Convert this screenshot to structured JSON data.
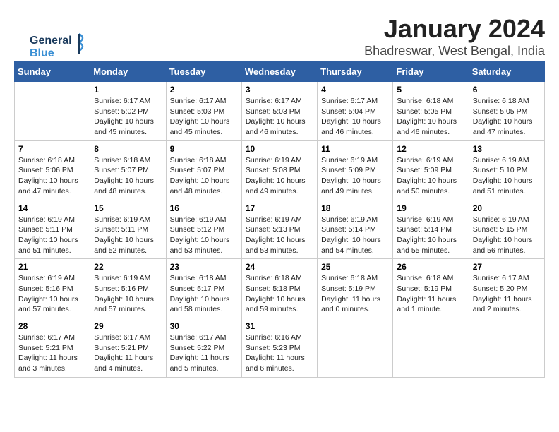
{
  "logo": {
    "line1": "General",
    "line2": "Blue"
  },
  "header": {
    "month_year": "January 2024",
    "location": "Bhadreswar, West Bengal, India"
  },
  "days_of_week": [
    "Sunday",
    "Monday",
    "Tuesday",
    "Wednesday",
    "Thursday",
    "Friday",
    "Saturday"
  ],
  "weeks": [
    [
      {
        "day": "",
        "sunrise": "",
        "sunset": "",
        "daylight": ""
      },
      {
        "day": "1",
        "sunrise": "Sunrise: 6:17 AM",
        "sunset": "Sunset: 5:02 PM",
        "daylight": "Daylight: 10 hours and 45 minutes."
      },
      {
        "day": "2",
        "sunrise": "Sunrise: 6:17 AM",
        "sunset": "Sunset: 5:03 PM",
        "daylight": "Daylight: 10 hours and 45 minutes."
      },
      {
        "day": "3",
        "sunrise": "Sunrise: 6:17 AM",
        "sunset": "Sunset: 5:03 PM",
        "daylight": "Daylight: 10 hours and 46 minutes."
      },
      {
        "day": "4",
        "sunrise": "Sunrise: 6:17 AM",
        "sunset": "Sunset: 5:04 PM",
        "daylight": "Daylight: 10 hours and 46 minutes."
      },
      {
        "day": "5",
        "sunrise": "Sunrise: 6:18 AM",
        "sunset": "Sunset: 5:05 PM",
        "daylight": "Daylight: 10 hours and 46 minutes."
      },
      {
        "day": "6",
        "sunrise": "Sunrise: 6:18 AM",
        "sunset": "Sunset: 5:05 PM",
        "daylight": "Daylight: 10 hours and 47 minutes."
      }
    ],
    [
      {
        "day": "7",
        "sunrise": "Sunrise: 6:18 AM",
        "sunset": "Sunset: 5:06 PM",
        "daylight": "Daylight: 10 hours and 47 minutes."
      },
      {
        "day": "8",
        "sunrise": "Sunrise: 6:18 AM",
        "sunset": "Sunset: 5:07 PM",
        "daylight": "Daylight: 10 hours and 48 minutes."
      },
      {
        "day": "9",
        "sunrise": "Sunrise: 6:18 AM",
        "sunset": "Sunset: 5:07 PM",
        "daylight": "Daylight: 10 hours and 48 minutes."
      },
      {
        "day": "10",
        "sunrise": "Sunrise: 6:19 AM",
        "sunset": "Sunset: 5:08 PM",
        "daylight": "Daylight: 10 hours and 49 minutes."
      },
      {
        "day": "11",
        "sunrise": "Sunrise: 6:19 AM",
        "sunset": "Sunset: 5:09 PM",
        "daylight": "Daylight: 10 hours and 49 minutes."
      },
      {
        "day": "12",
        "sunrise": "Sunrise: 6:19 AM",
        "sunset": "Sunset: 5:09 PM",
        "daylight": "Daylight: 10 hours and 50 minutes."
      },
      {
        "day": "13",
        "sunrise": "Sunrise: 6:19 AM",
        "sunset": "Sunset: 5:10 PM",
        "daylight": "Daylight: 10 hours and 51 minutes."
      }
    ],
    [
      {
        "day": "14",
        "sunrise": "Sunrise: 6:19 AM",
        "sunset": "Sunset: 5:11 PM",
        "daylight": "Daylight: 10 hours and 51 minutes."
      },
      {
        "day": "15",
        "sunrise": "Sunrise: 6:19 AM",
        "sunset": "Sunset: 5:11 PM",
        "daylight": "Daylight: 10 hours and 52 minutes."
      },
      {
        "day": "16",
        "sunrise": "Sunrise: 6:19 AM",
        "sunset": "Sunset: 5:12 PM",
        "daylight": "Daylight: 10 hours and 53 minutes."
      },
      {
        "day": "17",
        "sunrise": "Sunrise: 6:19 AM",
        "sunset": "Sunset: 5:13 PM",
        "daylight": "Daylight: 10 hours and 53 minutes."
      },
      {
        "day": "18",
        "sunrise": "Sunrise: 6:19 AM",
        "sunset": "Sunset: 5:14 PM",
        "daylight": "Daylight: 10 hours and 54 minutes."
      },
      {
        "day": "19",
        "sunrise": "Sunrise: 6:19 AM",
        "sunset": "Sunset: 5:14 PM",
        "daylight": "Daylight: 10 hours and 55 minutes."
      },
      {
        "day": "20",
        "sunrise": "Sunrise: 6:19 AM",
        "sunset": "Sunset: 5:15 PM",
        "daylight": "Daylight: 10 hours and 56 minutes."
      }
    ],
    [
      {
        "day": "21",
        "sunrise": "Sunrise: 6:19 AM",
        "sunset": "Sunset: 5:16 PM",
        "daylight": "Daylight: 10 hours and 57 minutes."
      },
      {
        "day": "22",
        "sunrise": "Sunrise: 6:19 AM",
        "sunset": "Sunset: 5:16 PM",
        "daylight": "Daylight: 10 hours and 57 minutes."
      },
      {
        "day": "23",
        "sunrise": "Sunrise: 6:18 AM",
        "sunset": "Sunset: 5:17 PM",
        "daylight": "Daylight: 10 hours and 58 minutes."
      },
      {
        "day": "24",
        "sunrise": "Sunrise: 6:18 AM",
        "sunset": "Sunset: 5:18 PM",
        "daylight": "Daylight: 10 hours and 59 minutes."
      },
      {
        "day": "25",
        "sunrise": "Sunrise: 6:18 AM",
        "sunset": "Sunset: 5:19 PM",
        "daylight": "Daylight: 11 hours and 0 minutes."
      },
      {
        "day": "26",
        "sunrise": "Sunrise: 6:18 AM",
        "sunset": "Sunset: 5:19 PM",
        "daylight": "Daylight: 11 hours and 1 minute."
      },
      {
        "day": "27",
        "sunrise": "Sunrise: 6:17 AM",
        "sunset": "Sunset: 5:20 PM",
        "daylight": "Daylight: 11 hours and 2 minutes."
      }
    ],
    [
      {
        "day": "28",
        "sunrise": "Sunrise: 6:17 AM",
        "sunset": "Sunset: 5:21 PM",
        "daylight": "Daylight: 11 hours and 3 minutes."
      },
      {
        "day": "29",
        "sunrise": "Sunrise: 6:17 AM",
        "sunset": "Sunset: 5:21 PM",
        "daylight": "Daylight: 11 hours and 4 minutes."
      },
      {
        "day": "30",
        "sunrise": "Sunrise: 6:17 AM",
        "sunset": "Sunset: 5:22 PM",
        "daylight": "Daylight: 11 hours and 5 minutes."
      },
      {
        "day": "31",
        "sunrise": "Sunrise: 6:16 AM",
        "sunset": "Sunset: 5:23 PM",
        "daylight": "Daylight: 11 hours and 6 minutes."
      },
      {
        "day": "",
        "sunrise": "",
        "sunset": "",
        "daylight": ""
      },
      {
        "day": "",
        "sunrise": "",
        "sunset": "",
        "daylight": ""
      },
      {
        "day": "",
        "sunrise": "",
        "sunset": "",
        "daylight": ""
      }
    ]
  ]
}
